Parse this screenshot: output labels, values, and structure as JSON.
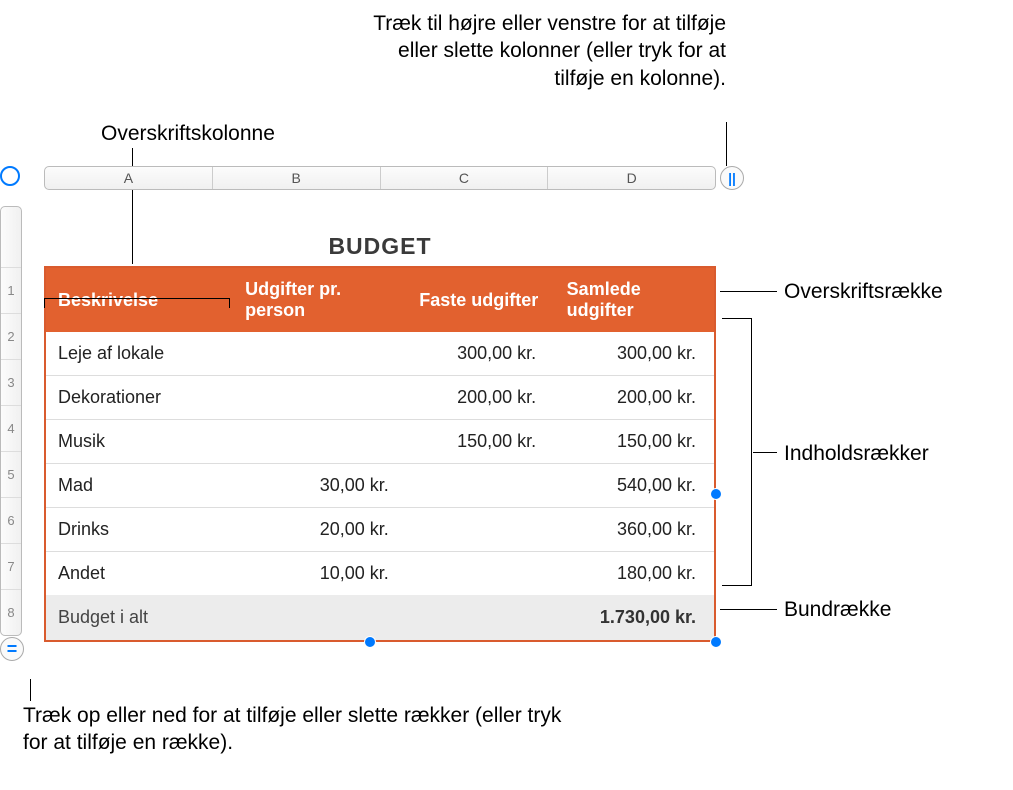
{
  "callouts": {
    "top_right": "Træk til højre eller venstre for at tilføje eller slette kolonner (eller tryk for at tilføje en kolonne).",
    "header_column": "Overskriftskolonne",
    "header_row": "Overskriftsrække",
    "body_rows": "Indholdsrækker",
    "footer_row": "Bundrække",
    "bottom": "Træk op eller ned for at tilføje eller slette rækker (eller tryk for at tilføje en række)."
  },
  "table": {
    "title": "BUDGET",
    "column_letters": [
      "A",
      "B",
      "C",
      "D"
    ],
    "row_numbers": [
      "1",
      "2",
      "3",
      "4",
      "5",
      "6",
      "7",
      "8"
    ],
    "headers": [
      "Beskrivelse",
      "Udgifter pr. person",
      "Faste udgifter",
      "Samlede udgifter"
    ],
    "rows": [
      {
        "desc": "Leje af lokale",
        "per": "",
        "fixed": "300,00 kr.",
        "total": "300,00 kr."
      },
      {
        "desc": "Dekorationer",
        "per": "",
        "fixed": "200,00 kr.",
        "total": "200,00 kr."
      },
      {
        "desc": "Musik",
        "per": "",
        "fixed": "150,00 kr.",
        "total": "150,00 kr."
      },
      {
        "desc": "Mad",
        "per": "30,00 kr.",
        "fixed": "",
        "total": "540,00 kr."
      },
      {
        "desc": "Drinks",
        "per": "20,00 kr.",
        "fixed": "",
        "total": "360,00 kr."
      },
      {
        "desc": "Andet",
        "per": "10,00 kr.",
        "fixed": "",
        "total": "180,00 kr."
      }
    ],
    "footer": {
      "desc": "Budget i alt",
      "per": "",
      "fixed": "",
      "total": "1.730,00 kr."
    }
  },
  "handles": {
    "column_handle_glyph": "||",
    "row_handle_glyph": "="
  }
}
